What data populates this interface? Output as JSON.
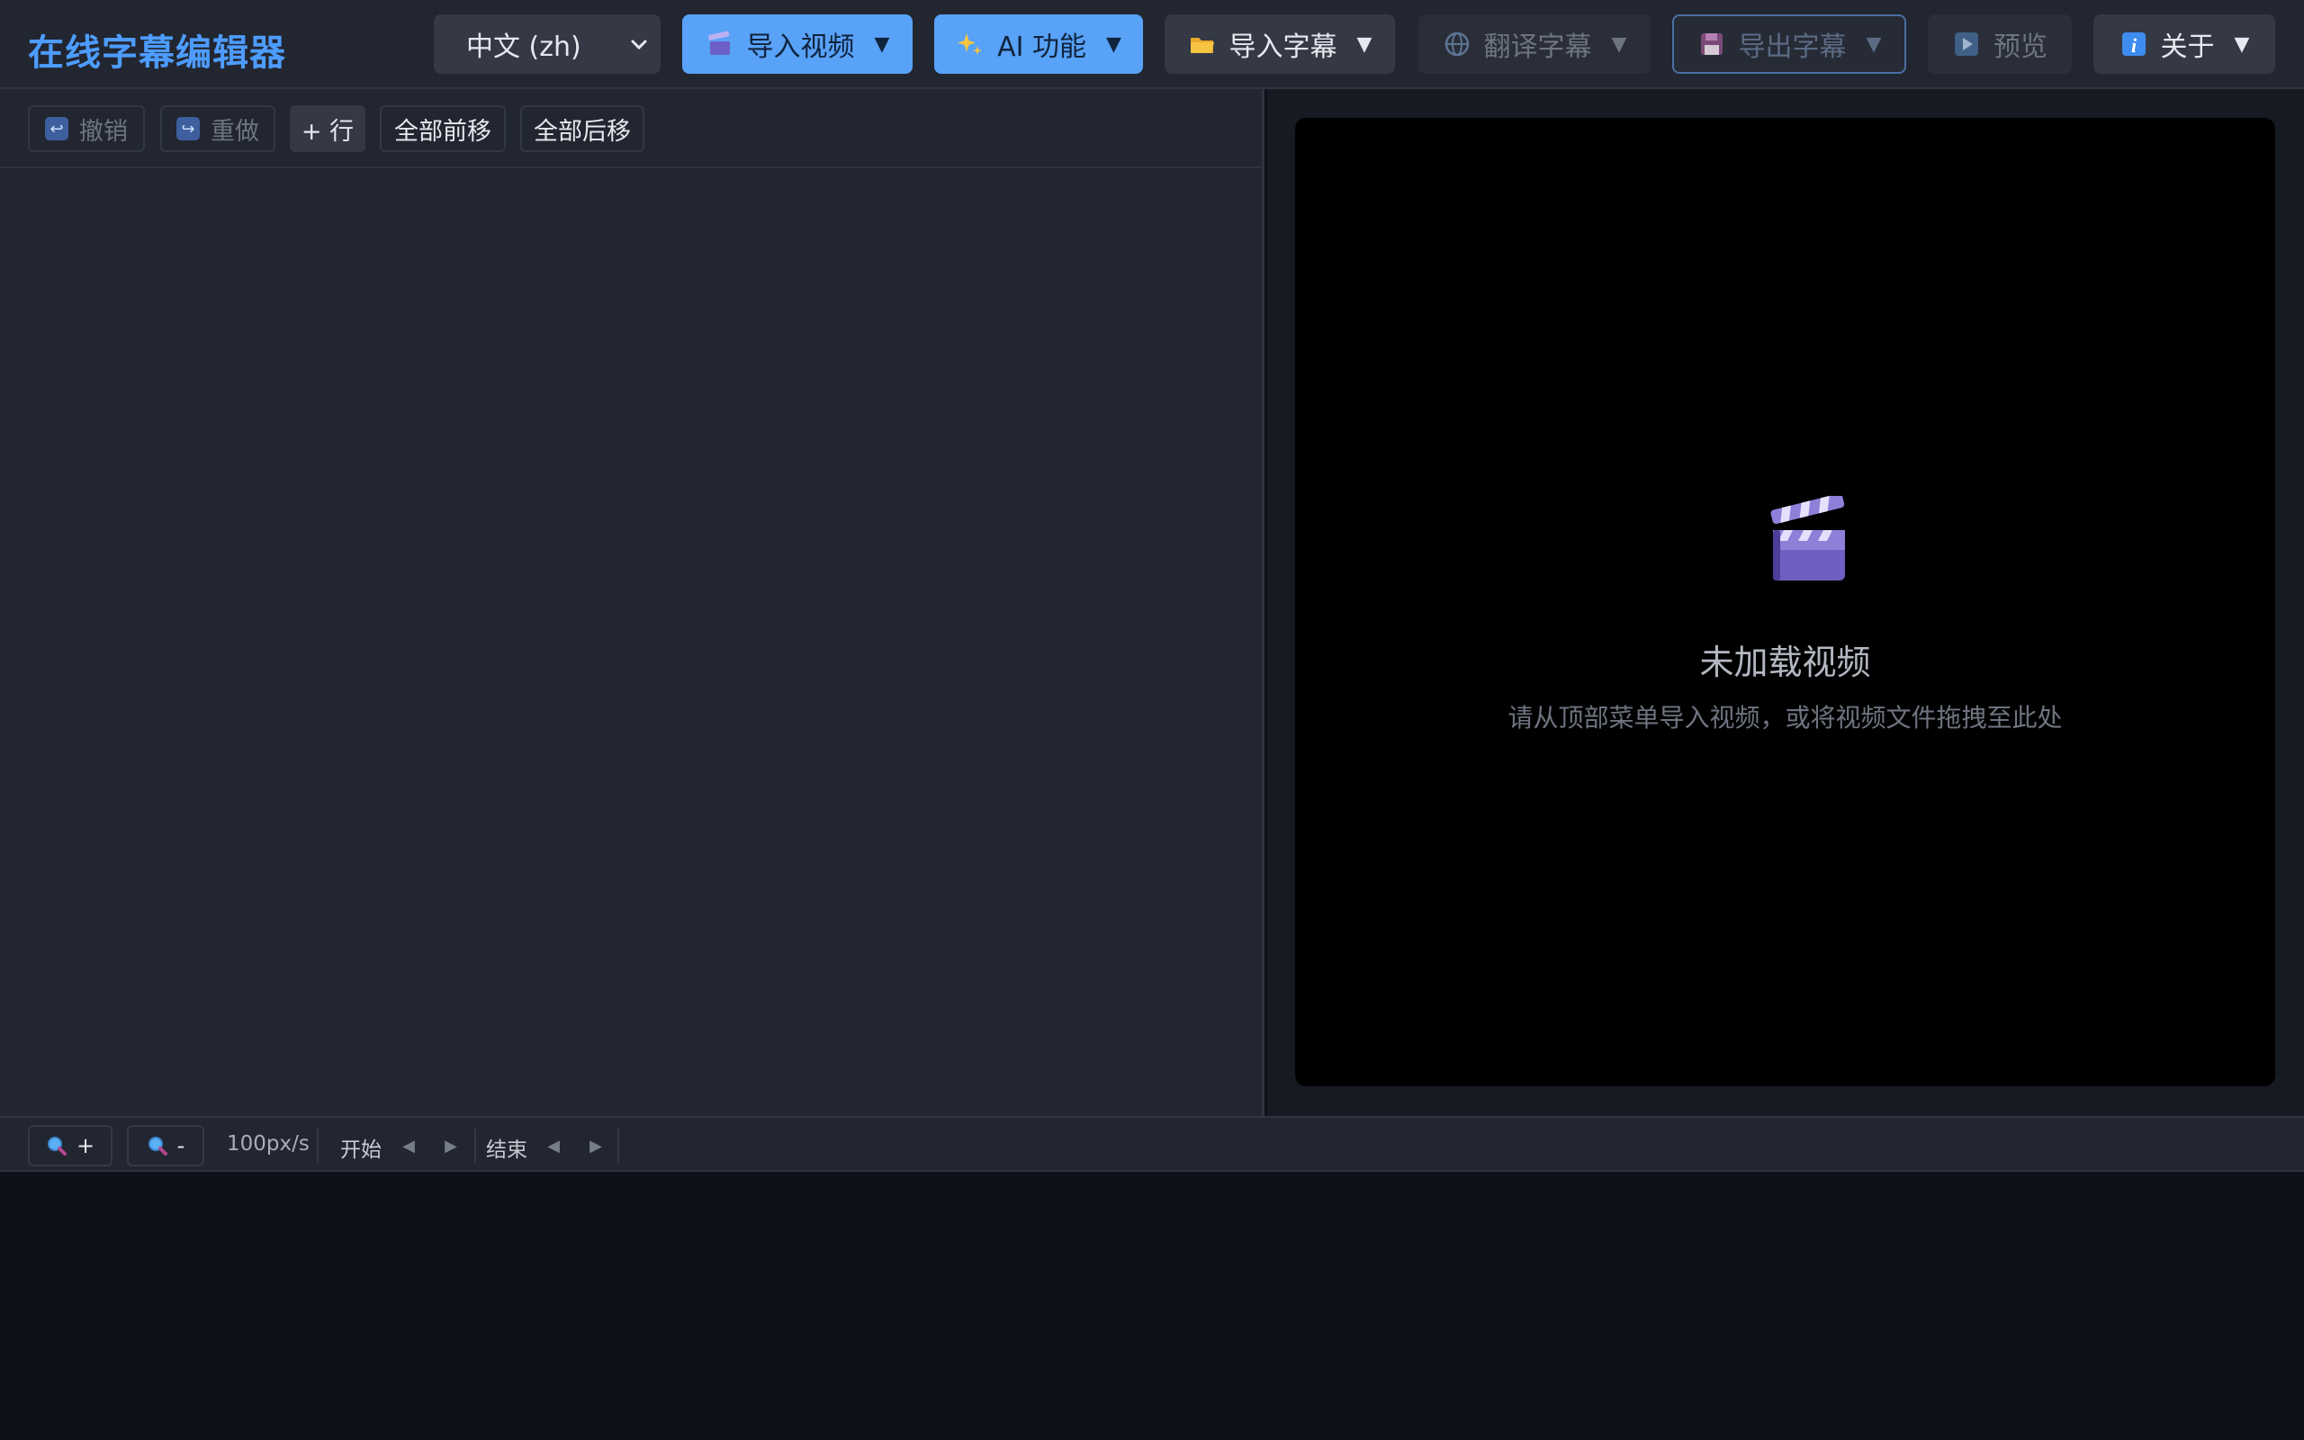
{
  "app": {
    "title": "在线字幕编辑器"
  },
  "topbar": {
    "language": {
      "selected": "中文 (zh)"
    },
    "import_video": {
      "label": "导入视频",
      "icon": "clapper-icon"
    },
    "ai_features": {
      "label": "AI 功能",
      "icon": "sparkles-icon"
    },
    "import_subtitles": {
      "label": "导入字幕",
      "icon": "folder-icon"
    },
    "translate_subtitles": {
      "label": "翻译字幕",
      "icon": "globe-icon"
    },
    "export_subtitles": {
      "label": "导出字幕",
      "icon": "floppy-icon"
    },
    "preview": {
      "label": "预览",
      "icon": "play-icon"
    },
    "about": {
      "label": "关于",
      "icon": "info-icon"
    },
    "caret": "▼"
  },
  "editor": {
    "toolbar": {
      "undo": "撤销",
      "redo": "重做",
      "add_row": "+ 行",
      "shift_all_earlier": "全部前移",
      "shift_all_later": "全部后移"
    },
    "rows": []
  },
  "video": {
    "placeholder_title": "未加载视频",
    "placeholder_hint": "请从顶部菜单导入视频，或将视频文件拖拽至此处"
  },
  "timeline": {
    "zoom_in": "+",
    "zoom_out": "-",
    "zoom_level": "100px/s",
    "start_label": "开始",
    "end_label": "结束",
    "left_arrow": "◀",
    "right_arrow": "▶"
  },
  "colors": {
    "accent": "#4d9cff",
    "primary_button": "#58a2f7",
    "panel_bg": "#222630",
    "page_bg": "#0e1119",
    "video_bg": "#000000"
  }
}
